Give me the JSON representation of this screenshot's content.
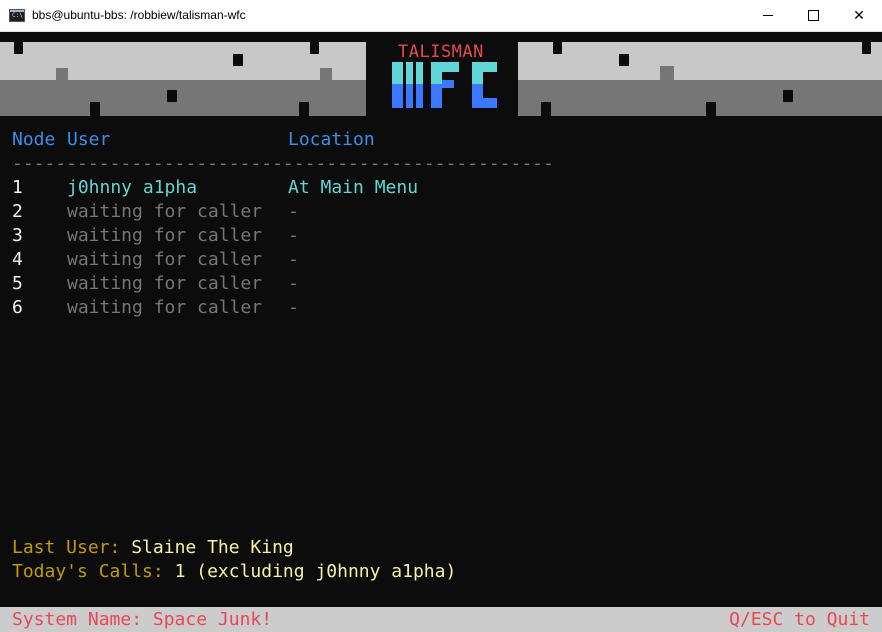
{
  "window": {
    "title": "bbs@ubuntu-bbs: /robbiew/talisman-wfc",
    "icon": "terminal-icon",
    "icon_text": "C:\\"
  },
  "banner": {
    "title": "TALISMAN",
    "logo_text": "WFC"
  },
  "table": {
    "headers": {
      "node": "Node",
      "user": "User",
      "location": "Location"
    },
    "separator": "--------------------------------------------------",
    "rows": [
      {
        "node": "1",
        "user": "j0hnny a1pha",
        "location": "At Main Menu",
        "active": true
      },
      {
        "node": "2",
        "user": "waiting for caller",
        "location": "-",
        "active": false
      },
      {
        "node": "3",
        "user": "waiting for caller",
        "location": "-",
        "active": false
      },
      {
        "node": "4",
        "user": "waiting for caller",
        "location": "-",
        "active": false
      },
      {
        "node": "5",
        "user": "waiting for caller",
        "location": "-",
        "active": false
      },
      {
        "node": "6",
        "user": "waiting for caller",
        "location": "-",
        "active": false
      }
    ]
  },
  "stats": {
    "last_user_label": "Last User: ",
    "last_user_value": "Slaine The King",
    "calls_label": "Today's Calls: ",
    "calls_value": "1 (excluding j0hnny a1pha)"
  },
  "status": {
    "system_name": "System Name: Space Junk!",
    "quit_hint": "Q/ESC to Quit"
  },
  "colors": {
    "background": "#0c0c0c",
    "header": "#3b8eea",
    "active": "#61d6d6",
    "idle": "#767676",
    "status": "#e74856",
    "label": "#c19c00",
    "value": "#f9f1a5"
  }
}
